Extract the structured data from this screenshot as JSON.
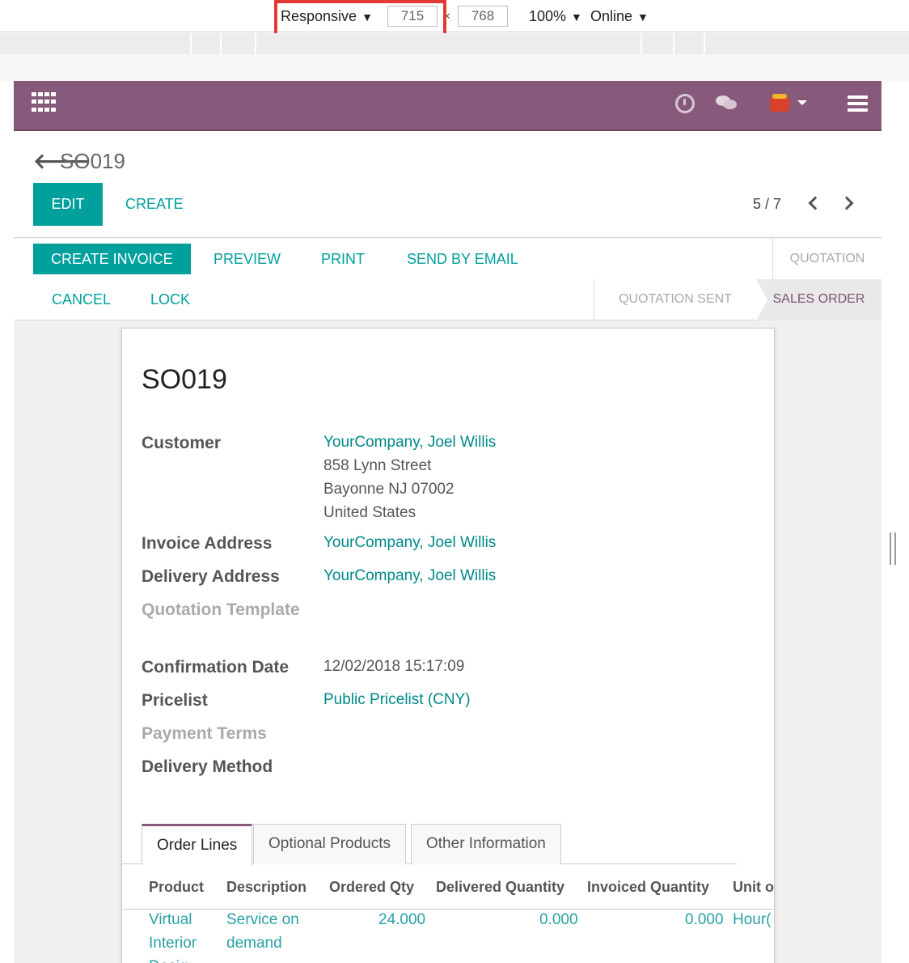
{
  "devtools": {
    "device": "Responsive",
    "width": "715",
    "times": "×",
    "height": "768",
    "zoom": "100%",
    "network": "Online"
  },
  "control_panel": {
    "breadcrumb": "SO019",
    "edit_label": "EDIT",
    "create_label": "CREATE",
    "pager_value": "5 / 7"
  },
  "statusbar": {
    "buttons": {
      "create_invoice": "CREATE INVOICE",
      "preview": "PREVIEW",
      "print": "PRINT",
      "send_by_email": "SEND BY EMAIL",
      "cancel": "CANCEL",
      "lock": "LOCK"
    },
    "stages": {
      "quotation": "QUOTATION",
      "quotation_sent": "QUOTATION SENT",
      "sales_order": "SALES ORDER"
    }
  },
  "sheet": {
    "title": "SO019",
    "customer_label": "Customer",
    "customer_name": "YourCompany, Joel Willis",
    "address_line1": "858 Lynn Street",
    "address_line2": "Bayonne NJ 07002",
    "address_line3": "United States",
    "invoice_address_label": "Invoice Address",
    "invoice_address_value": "YourCompany, Joel Willis",
    "delivery_address_label": "Delivery Address",
    "delivery_address_value": "YourCompany, Joel Willis",
    "quotation_template_label": "Quotation Template",
    "confirmation_date_label": "Confirmation Date",
    "confirmation_date_value": "12/02/2018 15:17:09",
    "pricelist_label": "Pricelist",
    "pricelist_value": "Public Pricelist (CNY)",
    "payment_terms_label": "Payment Terms",
    "delivery_method_label": "Delivery Method"
  },
  "tabs": {
    "order_lines": "Order Lines",
    "optional_products": "Optional Products",
    "other_information": "Other Information"
  },
  "table": {
    "headers": {
      "product": "Product",
      "description": "Description",
      "ordered_qty": "Ordered Qty",
      "delivered_qty": "Delivered Quantity",
      "invoiced_qty": "Invoiced Quantity",
      "unit": "Unit o"
    },
    "rows": [
      {
        "product_line1": "Virtual",
        "product_line2": "Interior",
        "product_line3": "Desig",
        "description_line1": "Service on",
        "description_line2": "demand",
        "ordered_qty": "24.000",
        "delivered_qty": "0.000",
        "invoiced_qty": "0.000",
        "unit": "Hour("
      }
    ]
  },
  "colors": {
    "brand": "#875a7b",
    "accent": "#00a09d",
    "link": "#00898a"
  }
}
